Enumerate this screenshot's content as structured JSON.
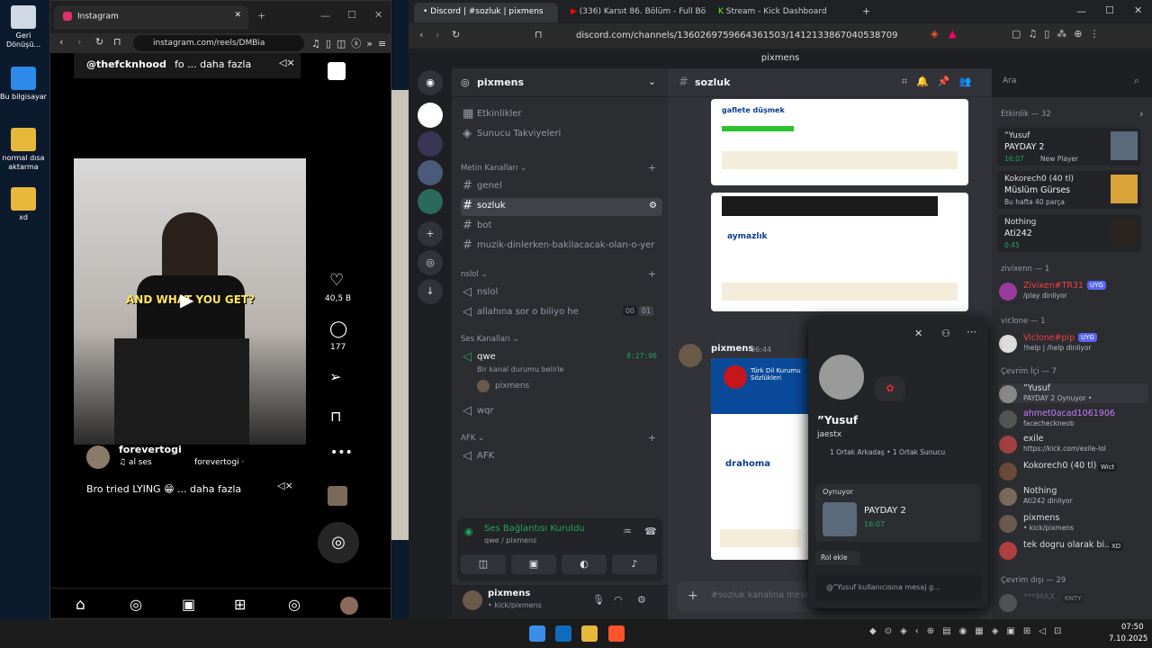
{
  "desktop": {
    "icons": [
      {
        "label": "Geri Dönüşü..."
      },
      {
        "label": "Bu bilgisayar"
      },
      {
        "label": "normal dısa aktarma"
      },
      {
        "label": "xd"
      }
    ]
  },
  "instagram": {
    "tab_title": "Instagram",
    "url": "instagram.com/reels/DMBia",
    "top_caption_user": "@thefcknhood",
    "top_caption_more": "fo ... daha fazla",
    "video_caption": "AND WHAT YOU GET?",
    "likes": "40,5 B",
    "comments": "177",
    "username": "forevertogi",
    "audio": "♫ al ses",
    "audio2": "forevertogi ·",
    "post_caption": "Bro tried LYING 😁 ... daha fazla"
  },
  "browser_tabs": [
    {
      "label": "• Discord | #sozluk | pixmens"
    },
    {
      "label": "(336) Karsıt 86. Bölüm - Full Bölüm"
    },
    {
      "label": "Stream - Kick Dashboard"
    }
  ],
  "discord": {
    "url": "discord.com/channels/1360269759664361503/1412133867040538709",
    "window_title": "pixmens",
    "server_name": "pixmens",
    "channel_header": "sozluk",
    "search_placeholder": "Ara",
    "menu": {
      "events": "Etkinlikler",
      "boosts": "Sunucu Takviyeleri"
    },
    "categories": {
      "text": "Metin Kanalları",
      "nslol": "nslol",
      "voice": "Ses Kanalları",
      "afk": "AFK"
    },
    "text_channels": [
      "genel",
      "sozluk",
      "bot",
      "muzik-dinlerken-bakilacacak-olan-o-yer"
    ],
    "nslol_channels": [
      "nslol",
      "allahına sor o biliyo he"
    ],
    "nslol_counter": [
      "00",
      "01"
    ],
    "voice_channel": {
      "name": "qwe",
      "time": "8:27:06",
      "status": "Bir kanal durumu belirle",
      "member": "pixmens"
    },
    "voice_channel2": "wqr",
    "afk_channel": "AFK",
    "voice_status": {
      "title": "Ses Bağlantısı Kuruldu",
      "sub": "qwe / pixmens"
    },
    "user": {
      "name": "pixmens",
      "status": "• kick/pixmens"
    },
    "chat_input_placeholder": "#sozluk kanalına mesaj",
    "message": {
      "author": "pixmens",
      "time": "06:44"
    },
    "embed1": {
      "word": "gaflete düşmek",
      "word2": "aymazlık"
    },
    "embed2": {
      "title": "Türk Dil Kurumu Sözlükleri",
      "word": "drahoma"
    },
    "profile": {
      "name": "”Yusuf",
      "handle": "jaestx",
      "mutual": "1 Ortak Arkadaş • 1 Ortak Sunucu",
      "activity_label": "Oynuyor",
      "game": "PAYDAY 2",
      "game_time": "16:07",
      "add_role": "Rol ekle",
      "message_placeholder": "@”Yusuf kullanıcısına mesaj g..."
    },
    "activity_header": "Etkinlik — 32",
    "activities": [
      {
        "name": "”Yusuf",
        "game": "PAYDAY 2",
        "time": "16:07",
        "extra": "New Player"
      },
      {
        "name": "Kokorech0 (40 tl)",
        "game": "Müslüm Gürses",
        "time": "Bu hafta 40 parça"
      },
      {
        "name": "Nothing",
        "game": "Ati242",
        "time": "0:45"
      }
    ],
    "groups": [
      {
        "header": "zivixenn — 1",
        "members": [
          {
            "name": "Zivixen#TR31",
            "status": "/play dinliyor",
            "badge": "UYG",
            "color": "#f23f43"
          }
        ]
      },
      {
        "header": "viclone — 1",
        "members": [
          {
            "name": "Viclone#pip",
            "status": "!help | /help dinliyor",
            "badge": "UYG",
            "color": "#f23f43"
          }
        ]
      },
      {
        "header": "Çevrim İçi — 7",
        "members": [
          {
            "name": "”Yusuf",
            "status": "PAYDAY 2 Oynuyor •",
            "color": "#dbdee1"
          },
          {
            "name": "ahmet0acad1061906",
            "status": "facecheckneob",
            "color": "#c77dff"
          },
          {
            "name": "exile",
            "status": "https://kick.com/exile-lol",
            "color": "#dbdee1"
          },
          {
            "name": "Kokorech0 (40 tl)",
            "status": "",
            "badge": "Wict",
            "color": "#dbdee1"
          },
          {
            "name": "Nothing",
            "status": "Ati242 dinliyor",
            "color": "#dbdee1"
          },
          {
            "name": "pixmens",
            "status": "• kick/pixmens",
            "color": "#dbdee1"
          },
          {
            "name": "tek dogru olarak bi...",
            "status": "",
            "badge": "XD",
            "color": "#dbdee1"
          }
        ]
      },
      {
        "header": "Çevrim dışı — 29",
        "members": [
          {
            "name": "***MAX",
            "status": "",
            "badge": "KNTY",
            "color": "#80848e"
          }
        ]
      }
    ]
  },
  "taskbar": {
    "time": "07:50",
    "date": "7.10.2025"
  }
}
